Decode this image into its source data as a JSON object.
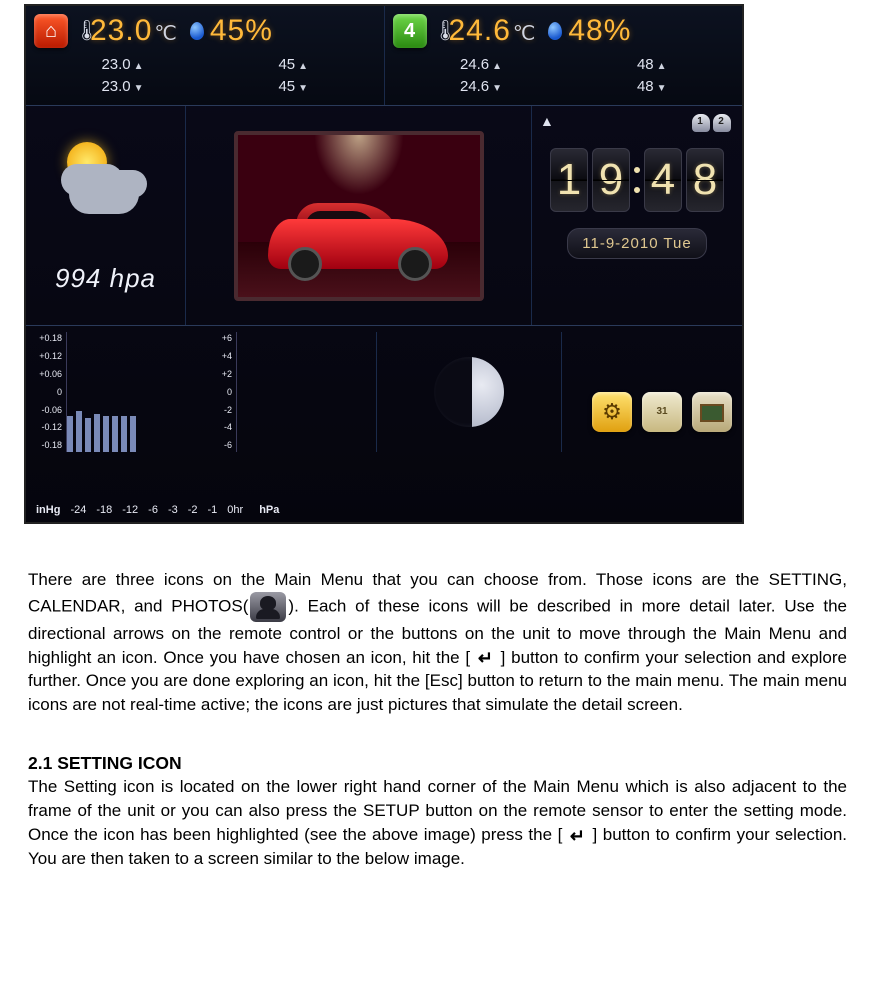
{
  "screen": {
    "sensor1": {
      "chip_label": "⌂",
      "temp": "23.0",
      "temp_unit": "℃",
      "hum": "45%",
      "temp_hi": "23.0",
      "temp_lo": "23.0",
      "hum_hi": "45",
      "hum_lo": "45"
    },
    "sensor2": {
      "chip_label": "4",
      "temp": "24.6",
      "temp_unit": "℃",
      "hum": "48%",
      "temp_hi": "24.6",
      "temp_lo": "24.6",
      "hum_hi": "48",
      "hum_lo": "48"
    },
    "pressure": "994 hpa",
    "clock_h1": "1",
    "clock_h2": "9",
    "clock_m1": "4",
    "clock_m2": "8",
    "alarm1": "1",
    "alarm2": "2",
    "date": "11-9-2010  Tue",
    "inhg_scale": [
      "+0.18",
      "+0.12",
      "+0.06",
      "0",
      "-0.06",
      "-0.12",
      "-0.18"
    ],
    "inhg_label": "inHg",
    "hpa_scale": [
      "+6",
      "+4",
      "+2",
      "0",
      "-2",
      "-4",
      "-6"
    ],
    "hpa_label": "hPa",
    "time_ticks": [
      "-24",
      "-18",
      "-12",
      "-6",
      "-3",
      "-2",
      "-1",
      "0hr"
    ],
    "cal_icon_text": "31"
  },
  "para1_a": "There are three icons on the Main Menu that you can choose from. Those icons are the SETTING, CALENDAR, and PHOTOS(",
  "para1_b": "). Each of these icons will be described in more detail later. Use the directional arrows on the remote control or the buttons on the unit to move through the Main Menu and highlight an icon. Once you have chosen an icon, hit the [ ",
  "para1_c": " ] button to confirm your selection and explore further. Once you are done exploring an icon, hit the [Esc] button to return to the main menu. The main menu icons are not real-time active; the icons are just pictures that simulate the detail screen.",
  "heading": "2.1 SETTING ICON",
  "para2_a": "The Setting icon is located on the lower right hand corner of the Main Menu which is also adjacent to the frame of the unit or you can also press the SETUP button on the remote sensor to enter the setting mode. Once the icon has been highlighted (see the above image) press the [ ",
  "para2_b": " ] button to confirm your selection. You are then taken to a screen similar to the below image.",
  "enter_glyph": "↵"
}
